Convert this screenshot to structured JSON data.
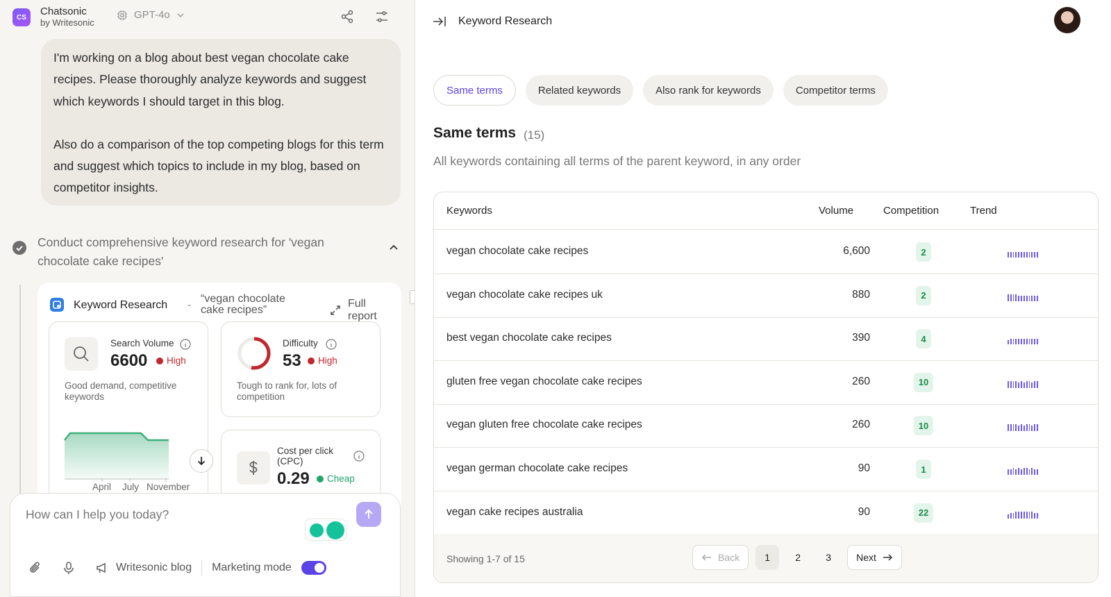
{
  "app": {
    "name": "Chatsonic",
    "byline": "by Writesonic",
    "logo_text": "CS",
    "model": "GPT-4o"
  },
  "chat": {
    "user_message_p1": "I'm working on a blog about best vegan chocolate cake recipes. Please thoroughly analyze keywords and suggest which keywords I should target in this blog.",
    "user_message_p2": "Also do a comparison of the top competing blogs for this term and suggest which topics to include in my blog, based on competitor insights.",
    "task_title": "Conduct comprehensive keyword research for 'vegan chocolate cake recipes'"
  },
  "kr_card": {
    "title": "Keyword Research",
    "dash": "-",
    "query": "“vegan chocolate cake recipes”",
    "full_report": "Full report",
    "search_volume": {
      "label": "Search Volume",
      "value": "6600",
      "level": "High",
      "desc": "Good demand, competitive keywords",
      "months": [
        "April",
        "July",
        "November"
      ]
    },
    "difficulty": {
      "label": "Difficulty",
      "value": "53",
      "level": "High",
      "desc": "Tough to rank for, lots of competition",
      "ring_value": 53
    },
    "cpc": {
      "label": "Cost per click (CPC)",
      "value": "0.29",
      "level": "Cheap"
    }
  },
  "composer": {
    "placeholder": "How can I help you today?",
    "writesonic_blog": "Writesonic blog",
    "marketing_mode": "Marketing mode",
    "marketing_mode_on": true
  },
  "panel": {
    "title": "Keyword Research",
    "tabs": [
      "Same terms",
      "Related keywords",
      "Also rank for keywords",
      "Competitor terms"
    ],
    "active_tab": 0,
    "section_title": "Same terms",
    "section_count": "(15)",
    "section_desc": "All keywords containing all terms of the parent keyword, in any order",
    "columns": {
      "keywords": "Keywords",
      "volume": "Volume",
      "competition": "Competition",
      "trend": "Trend"
    },
    "rows": [
      {
        "keyword": "vegan chocolate cake recipes",
        "volume": "6,600",
        "competition": "2",
        "trend": [
          8,
          8,
          8,
          8,
          8,
          8,
          8,
          8,
          8,
          8,
          8,
          8
        ]
      },
      {
        "keyword": "vegan chocolate cake recipes uk",
        "volume": "880",
        "competition": "2",
        "trend": [
          10,
          10,
          10,
          10,
          8,
          8,
          8,
          8,
          8,
          8,
          8,
          8
        ]
      },
      {
        "keyword": "best vegan chocolate cake recipes",
        "volume": "390",
        "competition": "4",
        "trend": [
          6,
          8,
          8,
          8,
          8,
          8,
          8,
          8,
          8,
          8,
          8,
          8
        ]
      },
      {
        "keyword": "gluten free vegan chocolate cake recipes",
        "volume": "260",
        "competition": "10",
        "trend": [
          10,
          10,
          10,
          10,
          8,
          10,
          8,
          10,
          10,
          8,
          10,
          10
        ]
      },
      {
        "keyword": "vegan gluten free chocolate cake recipes",
        "volume": "260",
        "competition": "10",
        "trend": [
          10,
          10,
          10,
          10,
          8,
          10,
          8,
          10,
          10,
          8,
          10,
          10
        ]
      },
      {
        "keyword": "vegan german chocolate cake recipes",
        "volume": "90",
        "competition": "1",
        "trend": [
          8,
          8,
          10,
          8,
          10,
          8,
          10,
          10,
          8,
          10,
          8,
          8
        ]
      },
      {
        "keyword": "vegan cake recipes australia",
        "volume": "90",
        "competition": "22",
        "trend": [
          6,
          8,
          8,
          10,
          10,
          10,
          10,
          10,
          10,
          10,
          8,
          8
        ]
      }
    ],
    "showing": "Showing 1-7 of 15",
    "pager": {
      "back": "Back",
      "pages": [
        "1",
        "2",
        "3"
      ],
      "current": "1",
      "next": "Next"
    }
  },
  "colors": {
    "accent": "#5b44e6",
    "high": "#c0282d",
    "cheap": "#22a667",
    "trend": "#6e5ae6",
    "badge_bg": "#e3f5ea",
    "badge_fg": "#1b8a4a",
    "volume_line": "#3fae7a"
  }
}
